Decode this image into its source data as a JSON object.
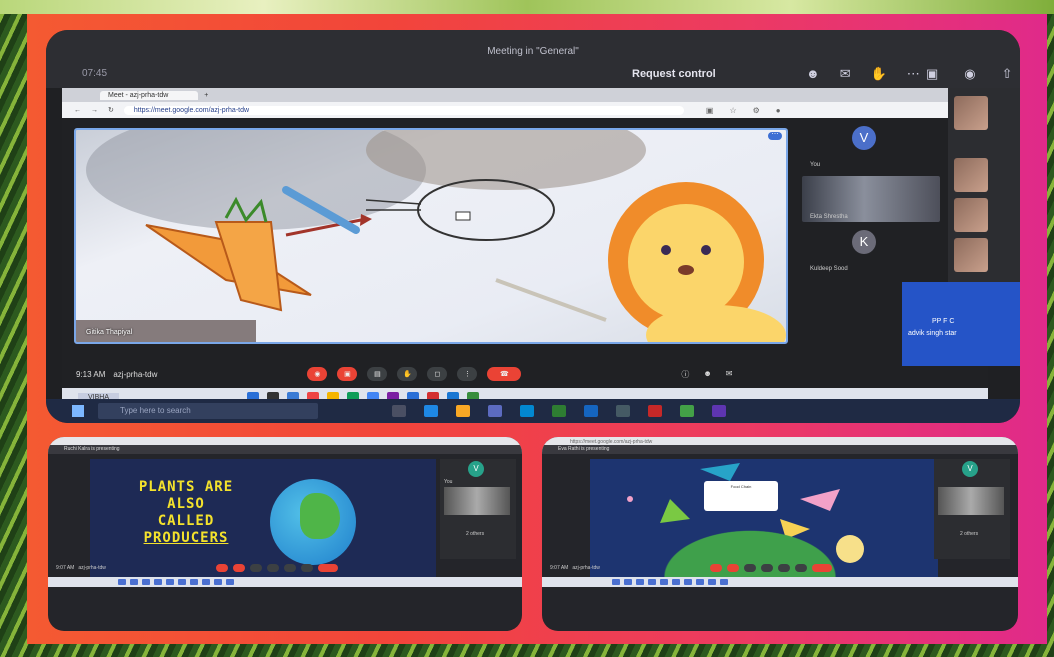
{
  "main": {
    "meeting_title": "Meeting in \"General\"",
    "time": "07:45",
    "request_control": "Request control",
    "browser": {
      "tab_title": "Meet - azj-prha-tdw",
      "url": "https://meet.google.com/azj-prha-tdw"
    },
    "presenter_name": "Gitika Thapiyal",
    "tiles": {
      "you_initial": "V",
      "you_label": "You",
      "participant_video_label": "Ekta Shrestha",
      "k_initial": "K",
      "k_label": "Kuldeep Sood"
    },
    "meet_time": "9:13 AM",
    "meet_code": "azj-prha-tdw",
    "taskbar_user": "VIBHA",
    "blue_tile": {
      "line1": "PP F C",
      "line2": "advik singh star"
    },
    "windows_search_placeholder": "Type here to search"
  },
  "left_sub": {
    "presenting": "Ruchi Kalra is presenting",
    "slide_line1": "PLANTS ARE",
    "slide_line2": "ALSO",
    "slide_line3": "CALLED",
    "slide_line4": "PRODUCERS",
    "you_initial": "V",
    "you_label": "You",
    "others": "2 others",
    "meet_time": "9:07 AM",
    "meet_code": "azj-prha-tdw"
  },
  "right_sub": {
    "presenting": "Eva Rathi is presenting",
    "url": "https://meet.google.com/azj-prha-tdw",
    "eco_label": "Food Chain",
    "you_initial": "V",
    "others": "2 others",
    "meet_time": "9:07 AM",
    "meet_code": "azj-prha-tdw"
  },
  "colors": {
    "gradient_start": "#f45a32",
    "gradient_end": "#e02a8a",
    "end_call": "#ea4335",
    "slide_text": "#f4e22c"
  }
}
